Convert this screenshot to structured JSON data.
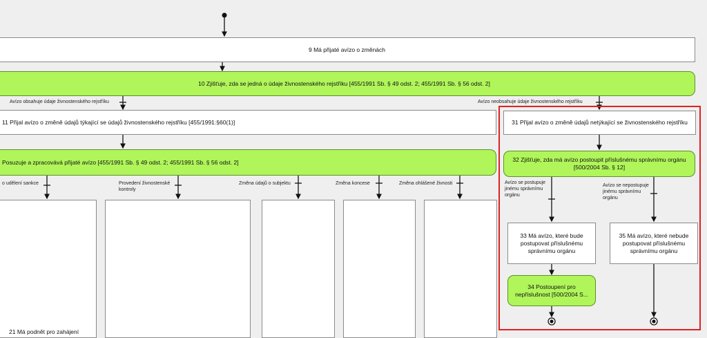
{
  "nodes": {
    "n9": "9 Má přijaté avízo o změnách",
    "n10": "10 Zjišťuje, zda se jedná o údaje živnostenského rejstříku [455/1991 Sb. § 49 odst. 2; 455/1991 Sb. § 56 odst. 2]",
    "n11": "11 Přijal avízo o změně údajů týkající se údajů živnostenského rejstříku [455/1991:§60(1)]",
    "n_posuzuje": "Posuzuje a zpracovává přijaté avízo [455/1991 Sb. § 49 odst. 2; 455/1991 Sb. § 56 odst. 2]",
    "n21": "21 Má podnět pro zahájení",
    "n31": "31 Přijal avízo o změně údajů netýkající se živnostenského rejstříku",
    "n32": "32 Zjišťuje, zda má avízo postoupit příslušnému správnímu orgánu [500/2004 Sb. § 12]",
    "n33": "33 Má avízo, které bude postupovat příslušnému správnímu orgánu",
    "n34": "34 Postoupení pro nepříslušnost [500/2004 S...",
    "n35": "35 Má avízo, které nebude postupovat příslušnému správnímu orgánu"
  },
  "labels": {
    "avizo_obsahuje": "Avízo obsahuje údaje živnostenského rejstříku",
    "avizo_neobsahuje": "Avízo neobsahuje údaje živnostenského rejstříku",
    "udeleni_sankce": "o udělení sankce",
    "provedeni_kontroly": "Provedení živnostenské kontroly",
    "zmena_udaju": "Změna údajů o subjektu",
    "zmena_koncese": "Změna koncese",
    "zmena_ohlasene": "Změna ohlášené živnosti",
    "postupuje": "Avízo se postupuje jinému správnímu orgánu",
    "nepostupuje": "Avízo se nepostupuje jinému správnímu orgánu"
  },
  "colors": {
    "activity_green": "#b0f55a",
    "highlight_red": "#e02020"
  }
}
